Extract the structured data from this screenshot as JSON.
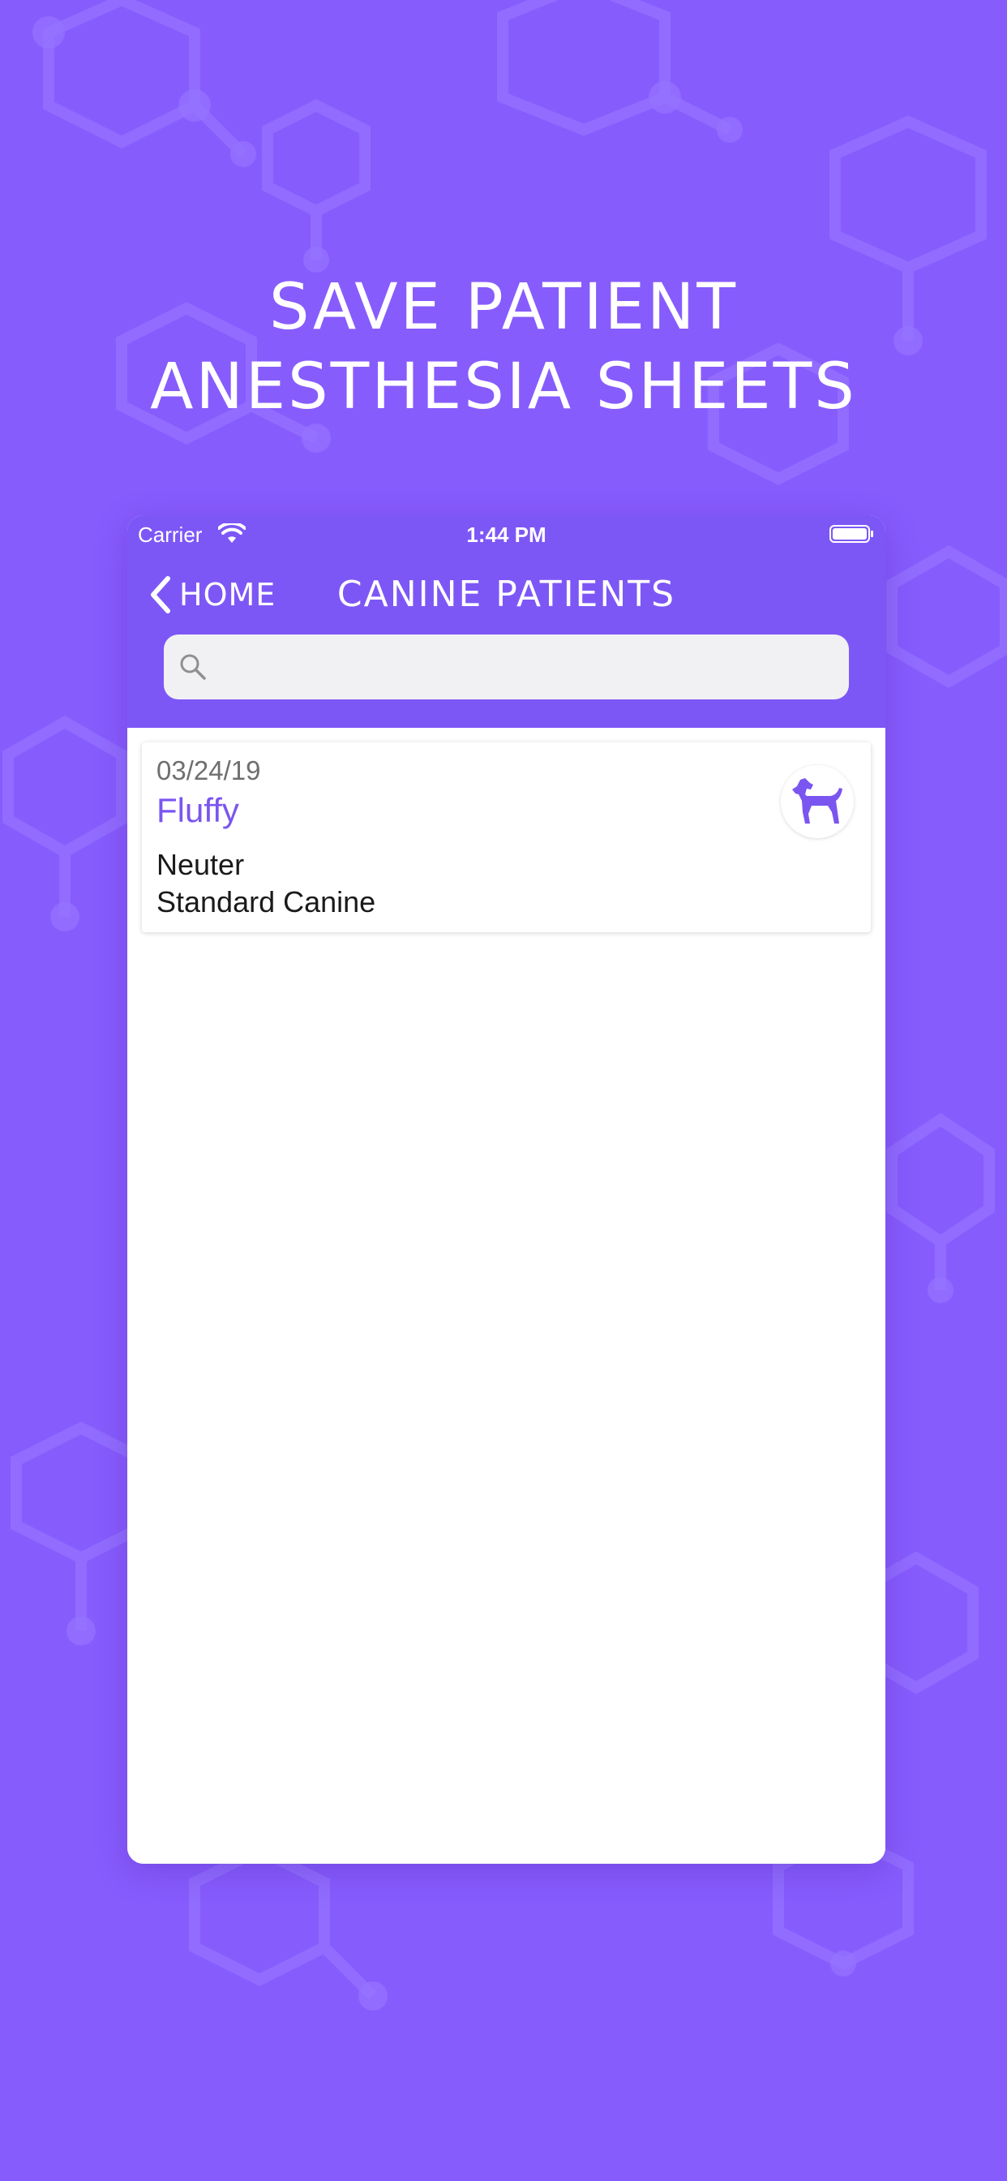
{
  "headline": {
    "line1": "SAVE PATIENT",
    "line2": "ANESTHESIA SHEETS"
  },
  "status_bar": {
    "carrier": "Carrier",
    "time": "1:44 PM",
    "wifi_icon": "wifi-icon",
    "battery_icon": "battery-icon"
  },
  "navbar": {
    "back_label": "HOME",
    "back_icon": "chevron-left-icon",
    "title": "CANINE PATIENTS"
  },
  "search": {
    "icon": "search-icon",
    "value": "",
    "placeholder": ""
  },
  "patients": [
    {
      "date": "03/24/19",
      "name": "Fluffy",
      "procedure": "Neuter",
      "protocol": "Standard Canine",
      "species_icon": "dog-icon"
    }
  ],
  "colors": {
    "background": "#875cfd",
    "navbar": "#7d57f6",
    "accent": "#7b55f0",
    "card": "#ffffff"
  }
}
